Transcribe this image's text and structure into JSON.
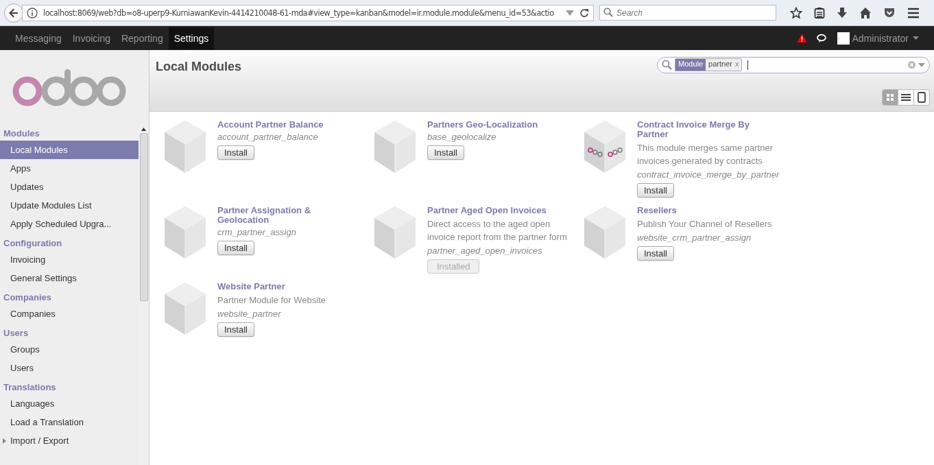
{
  "browser": {
    "url": "localhost:8069/web?db=o8-uperp9-KurniawanKevin-4414210048-61-mda#view_type=kanban&model=ir.module.module&menu_id=53&actio",
    "search_placeholder": "Search"
  },
  "top_menu": [
    {
      "label": "Messaging",
      "selected": false
    },
    {
      "label": "Invoicing",
      "selected": false
    },
    {
      "label": "Reporting",
      "selected": false
    },
    {
      "label": "Settings",
      "selected": true
    }
  ],
  "user": {
    "name": "Administrator"
  },
  "sidebar": [
    {
      "title": "Modules",
      "items": [
        {
          "label": "Local Modules",
          "selected": true
        },
        {
          "label": "Apps",
          "selected": false
        },
        {
          "label": "Updates",
          "selected": false
        },
        {
          "label": "Update Modules List",
          "selected": false
        },
        {
          "label": "Apply Scheduled Upgra...",
          "selected": false
        }
      ]
    },
    {
      "title": "Configuration",
      "items": [
        {
          "label": "Invoicing",
          "selected": false
        },
        {
          "label": "General Settings",
          "selected": false
        }
      ]
    },
    {
      "title": "Companies",
      "items": [
        {
          "label": "Companies",
          "selected": false
        }
      ]
    },
    {
      "title": "Users",
      "items": [
        {
          "label": "Groups",
          "selected": false
        },
        {
          "label": "Users",
          "selected": false
        }
      ]
    },
    {
      "title": "Translations",
      "items": [
        {
          "label": "Languages",
          "selected": false
        },
        {
          "label": "Load a Translation",
          "selected": false
        },
        {
          "label": "Import / Export",
          "selected": false,
          "expanded": false
        }
      ]
    }
  ],
  "page_title": "Local Modules",
  "search": {
    "facets": [
      {
        "category": "Module",
        "value": "partner",
        "remove": "x"
      }
    ]
  },
  "views": [
    {
      "kind": "kanban",
      "selected": true
    },
    {
      "kind": "list",
      "selected": false
    },
    {
      "kind": "form",
      "selected": false
    }
  ],
  "modules": [
    {
      "title": "Account Partner Balance",
      "technical_name": "account_partner_balance",
      "button": "Install",
      "installed": false,
      "kind": "cube"
    },
    {
      "title": "Partners Geo-Localization",
      "technical_name": "base_geolocalize",
      "button": "Install",
      "installed": false,
      "kind": "cube"
    },
    {
      "title": "Contract Invoice Merge By Partner",
      "description": "This module merges same partner invoices generated by contracts",
      "technical_name": "contract_invoice_merge_by_partner",
      "button": "Install",
      "installed": false,
      "kind": "logo-cube"
    },
    {
      "title": "Partner Assignation & Geolocation",
      "technical_name": "crm_partner_assign",
      "button": "Install",
      "installed": false,
      "kind": "cube"
    },
    {
      "title": "Partner Aged Open Invoices",
      "description": "Direct access to the aged open invoice report from the partner form",
      "technical_name": "partner_aged_open_invoices",
      "button": "Installed",
      "installed": true,
      "kind": "cube"
    },
    {
      "title": "Resellers",
      "description": "Publish Your Channel of Resellers",
      "technical_name": "website_crm_partner_assign",
      "button": "Install",
      "installed": false,
      "kind": "cube"
    },
    {
      "title": "Website Partner",
      "description": "Partner Module for Website",
      "technical_name": "website_partner",
      "button": "Install",
      "installed": false,
      "kind": "cube"
    }
  ]
}
